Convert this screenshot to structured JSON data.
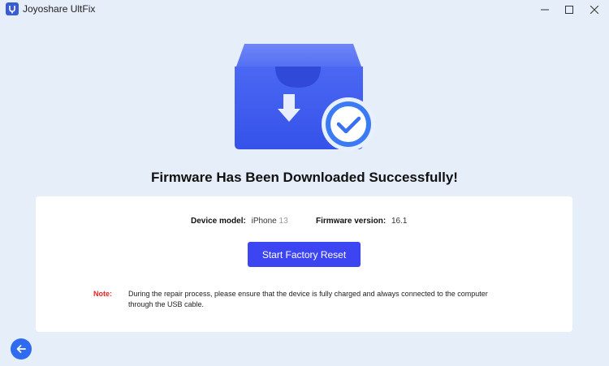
{
  "window": {
    "title": "Joyoshare UltFix",
    "minimize_glyph": "—",
    "maximize_glyph": "□",
    "close_glyph": "✕"
  },
  "main": {
    "headline": "Firmware Has Been Downloaded Successfully!",
    "device_model_label": "Device model:",
    "device_model_value_main": "iPhone",
    "device_model_value_num": "13",
    "firmware_label": "Firmware version:",
    "firmware_value": "16.1",
    "primary_button_label": "Start Factory Reset",
    "note_label": "Note:",
    "note_text": "During the repair process, please ensure that the device is fully charged and always connected to the computer through the USB cable."
  },
  "icons": {
    "hero": "firmware-box-download-icon",
    "check": "check-circle-icon",
    "back": "arrow-left-icon"
  },
  "colors": {
    "background": "#e6eef9",
    "primary": "#3d44f2",
    "box_blue": "#3b5ef0",
    "check_blue": "#3a7bf5",
    "note_red": "#e22222",
    "back_button": "#2f6bf0"
  }
}
